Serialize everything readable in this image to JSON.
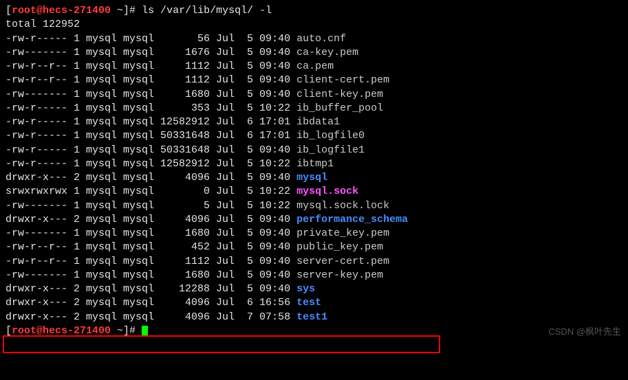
{
  "prompt1": {
    "user": "root",
    "host": "hecs-271400",
    "path": "~",
    "command": "ls /var/lib/mysql/ -l"
  },
  "total_line": "total 122952",
  "listing": [
    {
      "perm": "-rw-r-----",
      "links": "1",
      "owner": "mysql",
      "group": "mysql",
      "size": "56",
      "month": "Jul",
      "day": "5",
      "time": "09:40",
      "name": "auto.cnf",
      "cls": "gray"
    },
    {
      "perm": "-rw-------",
      "links": "1",
      "owner": "mysql",
      "group": "mysql",
      "size": "1676",
      "month": "Jul",
      "day": "5",
      "time": "09:40",
      "name": "ca-key.pem",
      "cls": "gray"
    },
    {
      "perm": "-rw-r--r--",
      "links": "1",
      "owner": "mysql",
      "group": "mysql",
      "size": "1112",
      "month": "Jul",
      "day": "5",
      "time": "09:40",
      "name": "ca.pem",
      "cls": "gray"
    },
    {
      "perm": "-rw-r--r--",
      "links": "1",
      "owner": "mysql",
      "group": "mysql",
      "size": "1112",
      "month": "Jul",
      "day": "5",
      "time": "09:40",
      "name": "client-cert.pem",
      "cls": "gray"
    },
    {
      "perm": "-rw-------",
      "links": "1",
      "owner": "mysql",
      "group": "mysql",
      "size": "1680",
      "month": "Jul",
      "day": "5",
      "time": "09:40",
      "name": "client-key.pem",
      "cls": "gray"
    },
    {
      "perm": "-rw-r-----",
      "links": "1",
      "owner": "mysql",
      "group": "mysql",
      "size": "353",
      "month": "Jul",
      "day": "5",
      "time": "10:22",
      "name": "ib_buffer_pool",
      "cls": "gray"
    },
    {
      "perm": "-rw-r-----",
      "links": "1",
      "owner": "mysql",
      "group": "mysql",
      "size": "12582912",
      "month": "Jul",
      "day": "6",
      "time": "17:01",
      "name": "ibdata1",
      "cls": "gray"
    },
    {
      "perm": "-rw-r-----",
      "links": "1",
      "owner": "mysql",
      "group": "mysql",
      "size": "50331648",
      "month": "Jul",
      "day": "6",
      "time": "17:01",
      "name": "ib_logfile0",
      "cls": "gray"
    },
    {
      "perm": "-rw-r-----",
      "links": "1",
      "owner": "mysql",
      "group": "mysql",
      "size": "50331648",
      "month": "Jul",
      "day": "5",
      "time": "09:40",
      "name": "ib_logfile1",
      "cls": "gray"
    },
    {
      "perm": "-rw-r-----",
      "links": "1",
      "owner": "mysql",
      "group": "mysql",
      "size": "12582912",
      "month": "Jul",
      "day": "5",
      "time": "10:22",
      "name": "ibtmp1",
      "cls": "gray"
    },
    {
      "perm": "drwxr-x---",
      "links": "2",
      "owner": "mysql",
      "group": "mysql",
      "size": "4096",
      "month": "Jul",
      "day": "5",
      "time": "09:40",
      "name": "mysql",
      "cls": "blue-bold"
    },
    {
      "perm": "srwxrwxrwx",
      "links": "1",
      "owner": "mysql",
      "group": "mysql",
      "size": "0",
      "month": "Jul",
      "day": "5",
      "time": "10:22",
      "name": "mysql.sock",
      "cls": "magenta-bold"
    },
    {
      "perm": "-rw-------",
      "links": "1",
      "owner": "mysql",
      "group": "mysql",
      "size": "5",
      "month": "Jul",
      "day": "5",
      "time": "10:22",
      "name": "mysql.sock.lock",
      "cls": "gray"
    },
    {
      "perm": "drwxr-x---",
      "links": "2",
      "owner": "mysql",
      "group": "mysql",
      "size": "4096",
      "month": "Jul",
      "day": "5",
      "time": "09:40",
      "name": "performance_schema",
      "cls": "blue-bold"
    },
    {
      "perm": "-rw-------",
      "links": "1",
      "owner": "mysql",
      "group": "mysql",
      "size": "1680",
      "month": "Jul",
      "day": "5",
      "time": "09:40",
      "name": "private_key.pem",
      "cls": "gray"
    },
    {
      "perm": "-rw-r--r--",
      "links": "1",
      "owner": "mysql",
      "group": "mysql",
      "size": "452",
      "month": "Jul",
      "day": "5",
      "time": "09:40",
      "name": "public_key.pem",
      "cls": "gray"
    },
    {
      "perm": "-rw-r--r--",
      "links": "1",
      "owner": "mysql",
      "group": "mysql",
      "size": "1112",
      "month": "Jul",
      "day": "5",
      "time": "09:40",
      "name": "server-cert.pem",
      "cls": "gray"
    },
    {
      "perm": "-rw-------",
      "links": "1",
      "owner": "mysql",
      "group": "mysql",
      "size": "1680",
      "month": "Jul",
      "day": "5",
      "time": "09:40",
      "name": "server-key.pem",
      "cls": "gray"
    },
    {
      "perm": "drwxr-x---",
      "links": "2",
      "owner": "mysql",
      "group": "mysql",
      "size": "12288",
      "month": "Jul",
      "day": "5",
      "time": "09:40",
      "name": "sys",
      "cls": "blue-bold"
    },
    {
      "perm": "drwxr-x---",
      "links": "2",
      "owner": "mysql",
      "group": "mysql",
      "size": "4096",
      "month": "Jul",
      "day": "6",
      "time": "16:56",
      "name": "test",
      "cls": "blue-bold"
    },
    {
      "perm": "drwxr-x---",
      "links": "2",
      "owner": "mysql",
      "group": "mysql",
      "size": "4096",
      "month": "Jul",
      "day": "7",
      "time": "07:58",
      "name": "test1",
      "cls": "blue-bold"
    }
  ],
  "prompt2": {
    "user": "root",
    "host": "hecs-271400",
    "path": "~"
  },
  "watermark": "CSDN @枫叶先生"
}
